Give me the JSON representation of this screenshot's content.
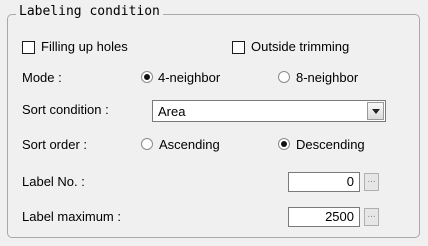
{
  "group": {
    "title": "Labeling condition"
  },
  "checkboxes": {
    "filling_up_holes": {
      "label": "Filling up holes",
      "checked": false
    },
    "outside_trimming": {
      "label": "Outside trimming",
      "checked": false
    }
  },
  "mode": {
    "label": "Mode :",
    "options": [
      "4-neighbor",
      "8-neighbor"
    ],
    "selected": "4-neighbor"
  },
  "sort_condition": {
    "label": "Sort condition :",
    "value": "Area"
  },
  "sort_order": {
    "label": "Sort order :",
    "options": [
      "Ascending",
      "Descending"
    ],
    "selected": "Descending"
  },
  "label_no": {
    "label": "Label No. :",
    "value": "0",
    "button": "..."
  },
  "label_maximum": {
    "label": "Label maximum :",
    "value": "2500",
    "button": "..."
  }
}
